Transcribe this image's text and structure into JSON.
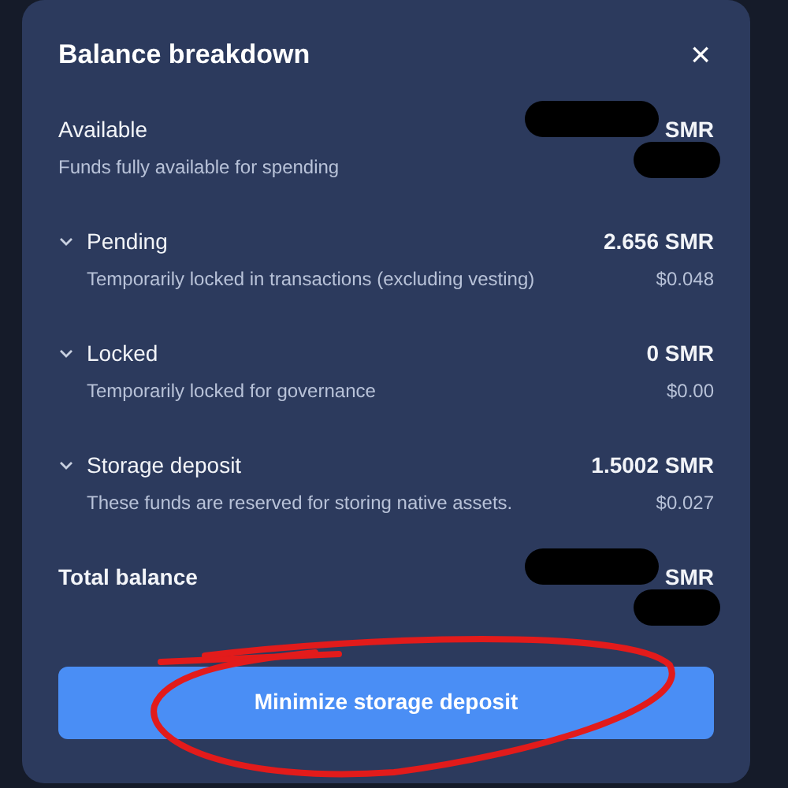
{
  "dialog": {
    "title": "Balance breakdown",
    "close": "×"
  },
  "rows": [
    {
      "kind": "plain",
      "label": "Available",
      "description": "Funds fully available for spending",
      "amount": "SMR",
      "redacted": true
    },
    {
      "kind": "collapsible",
      "label": "Pending",
      "description": "Temporarily locked in transactions (excluding vesting)",
      "amount": "2.656 SMR",
      "fiat": "$0.048",
      "redacted": false
    },
    {
      "kind": "collapsible",
      "label": "Locked",
      "description": "Temporarily locked for governance",
      "amount": "0 SMR",
      "fiat": "$0.00",
      "redacted": false
    },
    {
      "kind": "collapsible",
      "label": "Storage deposit",
      "description": "These funds are reserved for storing native assets.",
      "amount": "1.5002 SMR",
      "fiat": "$0.027",
      "redacted": false
    },
    {
      "kind": "total",
      "label": "Total balance",
      "amount": "SMR",
      "redacted": true
    }
  ],
  "button": "Minimize storage deposit",
  "annotation": {
    "kind": "circled"
  }
}
